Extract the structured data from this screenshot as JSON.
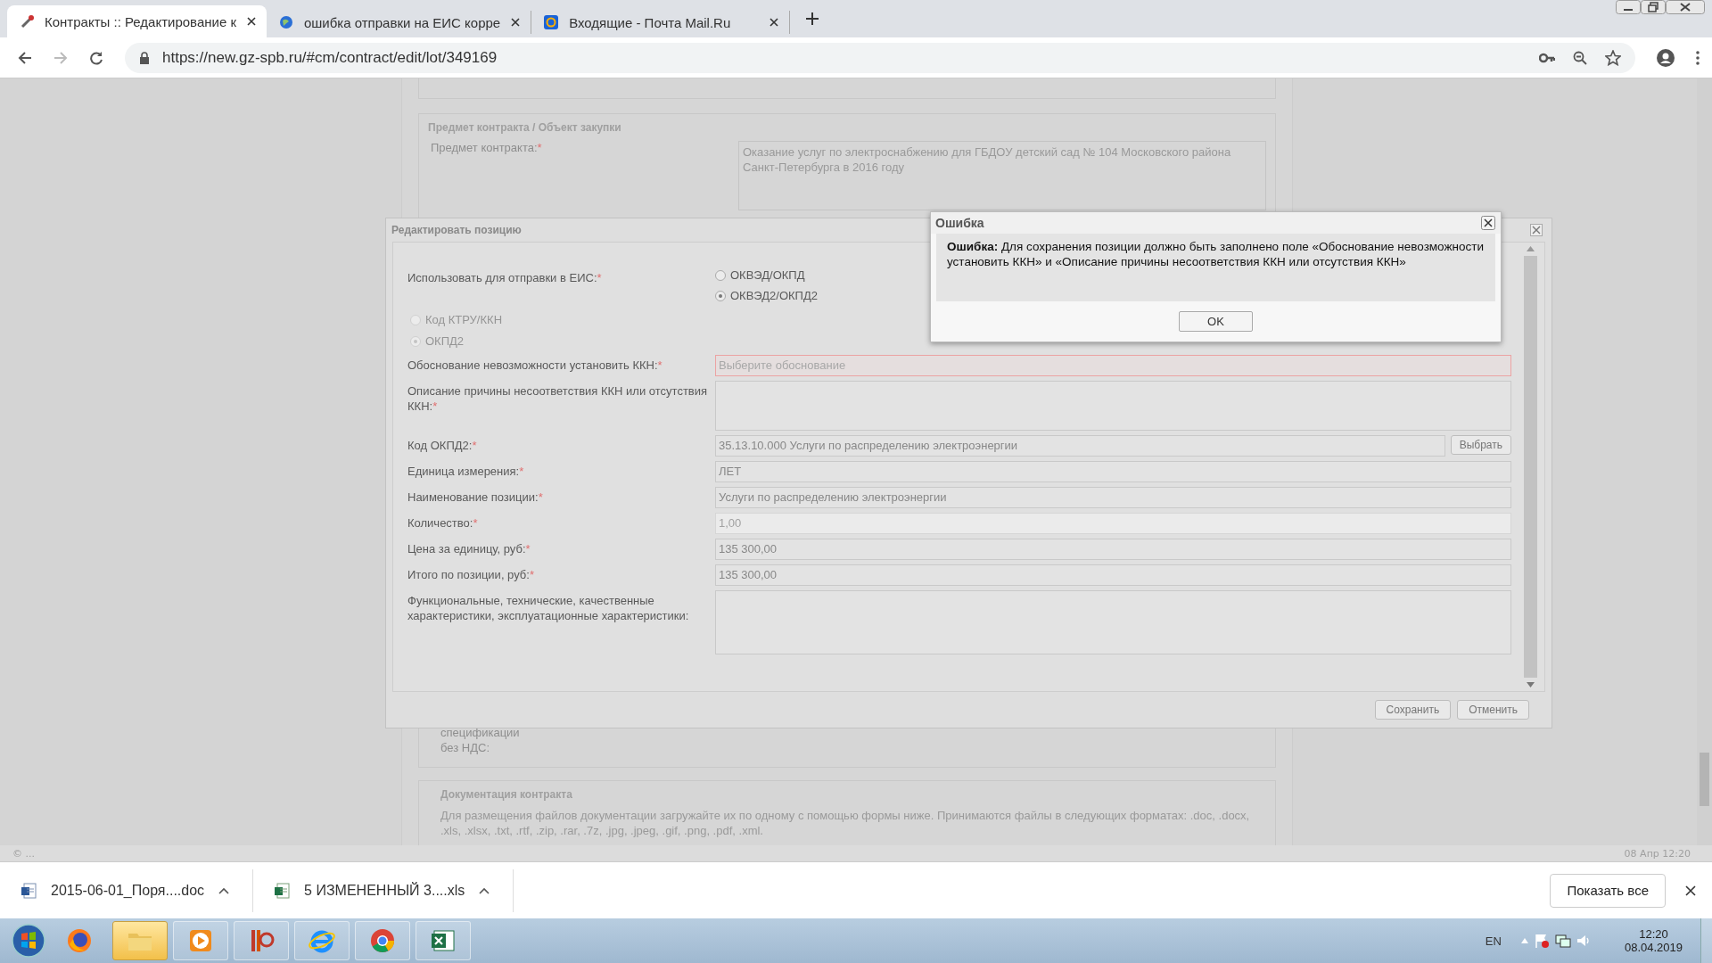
{
  "browser": {
    "tabs": [
      {
        "title": "Контракты :: Редактирование к",
        "selected": true,
        "kind": "tools"
      },
      {
        "title": "ошибка отправки на ЕИС корре",
        "selected": false,
        "kind": "globe"
      },
      {
        "title": "Входящие - Почта Mail.Ru",
        "selected": false,
        "kind": "mail"
      }
    ],
    "address": {
      "url": "https://new.gz-spb.ru/#cm/contract/edit/lot/349169"
    }
  },
  "page": {
    "section": {
      "legend": "Предмет контракта / Объект закупки",
      "label": "Предмет контракта:",
      "required_mark": "*",
      "value": "Оказание услуг по электроснабжению для ГБДОУ детский сад № 104 Московского района Санкт-Петербурга в 2016 году"
    },
    "partial_label": [
      "спецификации",
      "без НДС:"
    ],
    "docs": {
      "legend": "Документация контракта",
      "text": "Для размещения файлов документации загружайте их по одному с помощью формы ниже. Принимаются файлы в следующих форматах: .doc, .docx, .xls, .xlsx, .txt, .rtf, .zip, .rar, .7z, .jpg, .jpeg, .gif, .png, .pdf, .xml."
    },
    "status_left": "© ...",
    "status_right": "08 Апр 12:20"
  },
  "modal": {
    "title": "Редактировать позицию",
    "rows": [
      {
        "kind": "radio",
        "label": "Использовать для отправки в ЕИС:",
        "required_mark": "*",
        "options": [
          {
            "label": "ОКВЭД/ОКПД",
            "selected": false
          },
          {
            "label": "ОКВЭД2/ОКПД2",
            "selected": true
          }
        ]
      },
      {
        "kind": "radio_plain",
        "disabled": true,
        "options": [
          {
            "label": "Код КТРУ/ККН",
            "selected": false
          },
          {
            "label": "ОКПД2",
            "selected": true
          }
        ]
      },
      {
        "kind": "select",
        "label": "Обоснование невозможности установить ККН:",
        "required_mark": "*",
        "placeholder": "Выберите обоснование",
        "invalid": true
      },
      {
        "kind": "textarea",
        "label": "Описание причины несоответствия ККН или отсутствия ККН:",
        "required_mark": "*"
      },
      {
        "kind": "picker",
        "label": "Код ОКПД2:",
        "required_mark": "*",
        "value": "35.13.10.000 Услуги по распределению электроэнергии",
        "button": "Выбрать"
      },
      {
        "kind": "text",
        "label": "Единица измерения:",
        "required_mark": "*",
        "value": "ЛЕТ",
        "disabled": false
      },
      {
        "kind": "text",
        "label": "Наименование позиции:",
        "required_mark": "*",
        "value": "Услуги по распределению электроэнергии",
        "disabled": false
      },
      {
        "kind": "text",
        "label": "Количество:",
        "required_mark": "*",
        "value": "1,00",
        "disabled": true
      },
      {
        "kind": "text",
        "label": "Цена за единицу, руб:",
        "required_mark": "*",
        "value": "135 300,00",
        "disabled": false
      },
      {
        "kind": "text",
        "label": "Итого по позиции, руб:",
        "required_mark": "*",
        "value": "135 300,00",
        "disabled": false
      },
      {
        "kind": "textarea",
        "label": "Функциональные, технические, качественные характеристики, эксплуатационные характеристики:"
      }
    ],
    "buttons": [
      "Сохранить",
      "Отменить"
    ]
  },
  "error_dialog": {
    "title": "Ошибка",
    "message": "**Ошибка:** Для сохранения позиции должно быть заполнено поле «Обоснование невозможности установить ККН» и «Описание причины несоответствия ККН или отсутствия ККН»",
    "button": "OK"
  },
  "downloads": {
    "items": [
      {
        "name": "2015-06-01_Поря....doc",
        "kind": "doc"
      },
      {
        "name": "5 ИЗМЕНЕННЫЙ 3....xls",
        "kind": "xls"
      }
    ],
    "show_all": "Показать все"
  },
  "taskbar": {
    "apps": [
      {
        "kind": "firefox"
      },
      {
        "kind": "folder",
        "selected": true
      },
      {
        "kind": "player",
        "selected": false
      },
      {
        "kind": "reader",
        "selected": false
      },
      {
        "kind": "ie",
        "selected": false
      },
      {
        "kind": "chrome",
        "selected": false
      },
      {
        "kind": "excel",
        "selected": false
      }
    ],
    "lang": "EN",
    "time": "12:20",
    "date": "08.04.2019"
  }
}
